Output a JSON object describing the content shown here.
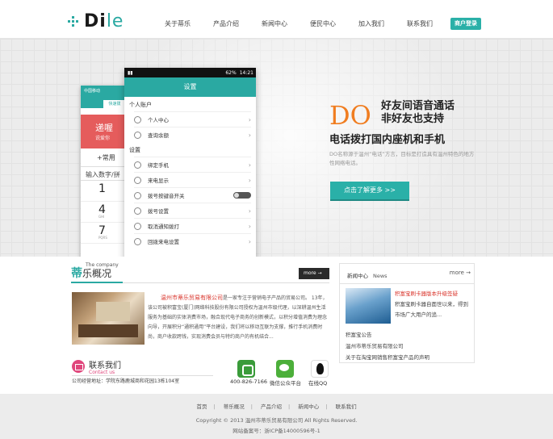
{
  "header": {
    "logo_text": "Di",
    "logo_tail": "le",
    "nav": [
      "关于蒂乐",
      "产品介绍",
      "新闻中心",
      "便民中心",
      "加入我们",
      "联系我们"
    ],
    "merchant_login": "商户登录"
  },
  "banner": {
    "back_phone": {
      "status": "中国移动",
      "tab": "快速拨",
      "red_big": "递喔",
      "red_small": "说爱你",
      "plus": "+常用",
      "input": "输入数字/拼",
      "keys": [
        {
          "num": "1",
          "sub": ""
        },
        {
          "num": "4",
          "sub": "GHI"
        },
        {
          "num": "7",
          "sub": "PQRS"
        }
      ]
    },
    "front_phone": {
      "status_battery": "62%",
      "status_time": "14:21",
      "title": "设置",
      "section_personal": "个人账户",
      "personal_items": [
        "个人中心",
        "查询余额"
      ],
      "section_settings": "设置",
      "settings_items": [
        "绑定手机",
        "来电显示",
        "拨号按键音开关",
        "拨号设置",
        "取消通知拨打",
        "回拨来电设置"
      ]
    },
    "promo_big": "DO",
    "promo_line1": "好友间语音通话",
    "promo_line2": "非好友也支持",
    "promo_line3": "电话拨打国内座机和手机",
    "promo_desc": "DO名称源于温州“电话”方言，目标是打造具有温州特色的地方性网络电话。",
    "learn_more": "点击了解更多 >>"
  },
  "company": {
    "title_prefix": "蒂",
    "title_rest": "乐概况",
    "title_en": "The company",
    "more": "more →",
    "highlight": "温州市蒂乐贸易有限公司",
    "text": "是一家专注于营销电子产品的贸易公司。 13年，该公司被积富宝(厦门)网络科技股份有限公司授权为温州市级代理，以深耕温州生活服务为基础的实体消费市场，融合现代电子商务的创新模式，以积分增值消费为理念向导，开展积分“通积通用”平台建设，我们将以移动互联为支撑，推行手机消费时尚，商户收款跨钱，实现消费会员与特约商户的有机结合..."
  },
  "contact": {
    "title": "联系我们",
    "title_en": "Contact us",
    "address": "公司经营地址：学院东路鹿城商和花园13栋104室",
    "phone": "400-826-7166",
    "wechat": "微信公众平台",
    "qq": "在线QQ"
  },
  "news": {
    "title": "新闻中心",
    "title_en": "News",
    "more": "more →",
    "headline": "积富宝刷卡器版本升级签疑",
    "summary": "积富宝刷卡器自面世以来，得到市场广大用户的追...",
    "links": [
      "积富宝公告",
      "温州市蒂乐贸易有限公司",
      "关于在淘宝网销售积富宝产品的声明"
    ]
  },
  "footer": {
    "nav": [
      "首页",
      "蒂乐概况",
      "产品介绍",
      "新闻中心",
      "联系我们"
    ],
    "copyright": "Copyright © 2013 温州市蒂乐贸易有限公司 All Rights Reserved.",
    "icp": "网站备案号：浙ICP备14000596号-1"
  }
}
